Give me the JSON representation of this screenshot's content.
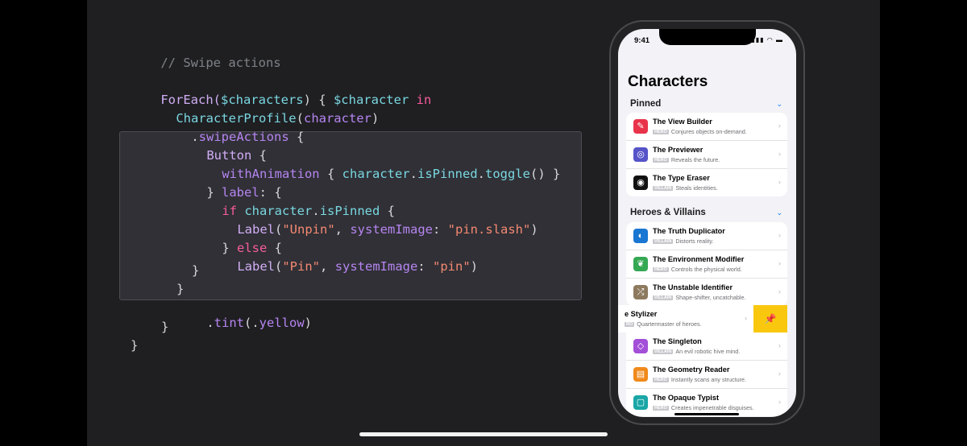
{
  "code": {
    "comment": "// Swipe actions",
    "l1": {
      "kw1": "ForEach(",
      "var": "$characters",
      "mid": ") { ",
      "var2": "$character",
      "in": " in"
    },
    "l2": {
      "ty": "CharacterProfile",
      "open": "(",
      "arg": "character",
      "close": ")"
    },
    "l3": {
      "dot": ".",
      "fn": "swipeActions",
      "rest": " {"
    },
    "l4": {
      "ty": "Button",
      "rest": " {"
    },
    "l5": {
      "fn": "withAnimation",
      "mid": " { ",
      "id1": "character",
      "dot1": ".",
      "id2": "isPinned",
      "dot2": ".",
      "id3": "toggle",
      "rest": "() }"
    },
    "l6": {
      "open": "} ",
      "fn": "label",
      "rest": ": {"
    },
    "l7": {
      "kw": "if",
      "sp": " ",
      "id1": "character",
      "dot": ".",
      "id2": "isPinned",
      "rest": " {"
    },
    "l8": {
      "ty": "Label",
      "open": "(",
      "str1": "\"Unpin\"",
      "comma": ", ",
      "param": "systemImage",
      "colon": ": ",
      "str2": "\"pin.slash\"",
      "close": ")"
    },
    "l9": {
      "open": "} ",
      "kw": "else",
      "rest": " {"
    },
    "l10": {
      "ty": "Label",
      "open": "(",
      "str1": "\"Pin\"",
      "comma": ", ",
      "param": "systemImage",
      "colon": ": ",
      "str2": "\"pin\"",
      "close": ")"
    },
    "l11": "}",
    "l12": "}",
    "l13": {
      "dot": ".",
      "fn": "tint",
      "open": "(.",
      "id": "yellow",
      "close": ")"
    },
    "l14": "}",
    "l15": "}"
  },
  "phone": {
    "time": "9:41",
    "status_icons": "▮▮▮ ◠ ▬",
    "title": "Characters",
    "sections": [
      {
        "label": "Pinned",
        "chevron": "⌄"
      },
      {
        "label": "Heroes & Villains",
        "chevron": "⌄"
      }
    ],
    "pinned": [
      {
        "name": "The View Builder",
        "tag": "HERO",
        "desc": "Conjures objects on-demand.",
        "color": "#e8334a",
        "glyph": "✎",
        "icon": "wand-icon"
      },
      {
        "name": "The Previewer",
        "tag": "HERO",
        "desc": "Reveals the future.",
        "color": "#5654c8",
        "glyph": "◎",
        "icon": "preview-icon"
      },
      {
        "name": "The Type Eraser",
        "tag": "VILLAIN",
        "desc": "Steals identities.",
        "color": "#111111",
        "glyph": "◉",
        "icon": "eye-icon"
      }
    ],
    "heroes": [
      {
        "name": "The Truth Duplicator",
        "tag": "VILLAIN",
        "desc": "Distorts reality.",
        "color": "#1976d2",
        "glyph": "◐",
        "icon": "duplicate-icon"
      },
      {
        "name": "The Environment Modifier",
        "tag": "HERO",
        "desc": "Controls the physical world.",
        "color": "#34a853",
        "glyph": "❦",
        "icon": "leaf-icon"
      },
      {
        "name": "The Unstable Identifier",
        "tag": "VILLAIN",
        "desc": "Shape-shifter, uncatchable.",
        "color": "#8d7a5e",
        "glyph": "⤮",
        "icon": "shuffle-icon"
      }
    ],
    "swiped": {
      "name": "e Stylizer",
      "tag": "RO",
      "desc": "Quartermaster of heroes.",
      "action_color": "#f9c80e",
      "action_glyph": "📌"
    },
    "heroes_after": [
      {
        "name": "The Singleton",
        "tag": "VILLAIN",
        "desc": "An evil robotic hive mind.",
        "color": "#a34fd8",
        "glyph": "◇",
        "icon": "diamond-icon"
      },
      {
        "name": "The Geometry Reader",
        "tag": "HERO",
        "desc": "Instantly scans any structure.",
        "color": "#f08a1c",
        "glyph": "▤",
        "icon": "ruler-icon"
      },
      {
        "name": "The Opaque Typist",
        "tag": "HERO",
        "desc": "Creates impenetrable disguises.",
        "color": "#1aa6a6",
        "glyph": "▢",
        "icon": "square-icon"
      }
    ],
    "row_chevron": "›"
  }
}
